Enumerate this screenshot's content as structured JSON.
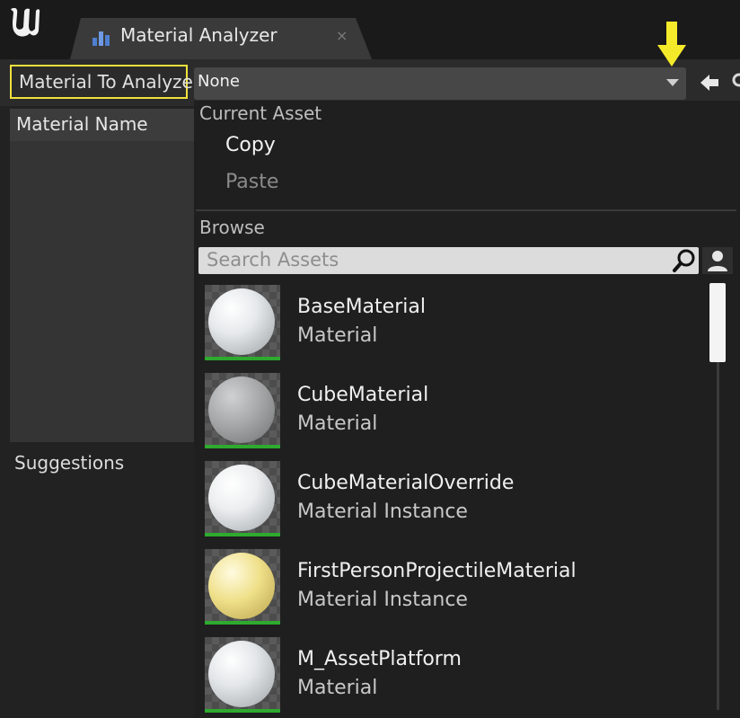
{
  "tab": {
    "title": "Material Analyzer",
    "close": "×"
  },
  "toolbar": {
    "material_label": "Material To Analyze:",
    "combo_value": "None"
  },
  "left": {
    "material_name_header": "Material Name",
    "suggestions": "Suggestions"
  },
  "menu": {
    "current_asset_header": "Current Asset",
    "copy": "Copy",
    "paste": "Paste",
    "browse_header": "Browse",
    "search_placeholder": "Search Assets"
  },
  "assets": [
    {
      "name": "BaseMaterial",
      "type": "Material",
      "sphere_color": "#e6e9eb"
    },
    {
      "name": "CubeMaterial",
      "type": "Material",
      "sphere_color": "#a6a8a9"
    },
    {
      "name": "CubeMaterialOverride",
      "type": "Material Instance",
      "sphere_color": "#eceeef"
    },
    {
      "name": "FirstPersonProjectileMaterial",
      "type": "Material Instance",
      "sphere_color": "#efe08a"
    },
    {
      "name": "M_AssetPlatform",
      "type": "Material",
      "sphere_color": "#e3e6e8"
    }
  ],
  "colors": {
    "highlight_border": "#f0e23c",
    "asset_status_bar": "#2eaa2e",
    "annotation_arrow": "#f5ea2a"
  },
  "icons": [
    "unreal-logo-icon",
    "material-analyzer-tab-icon",
    "close-icon",
    "dropdown-arrow-icon",
    "annotation-arrow-icon",
    "back-arrow-icon",
    "search-icon",
    "user-icon"
  ]
}
